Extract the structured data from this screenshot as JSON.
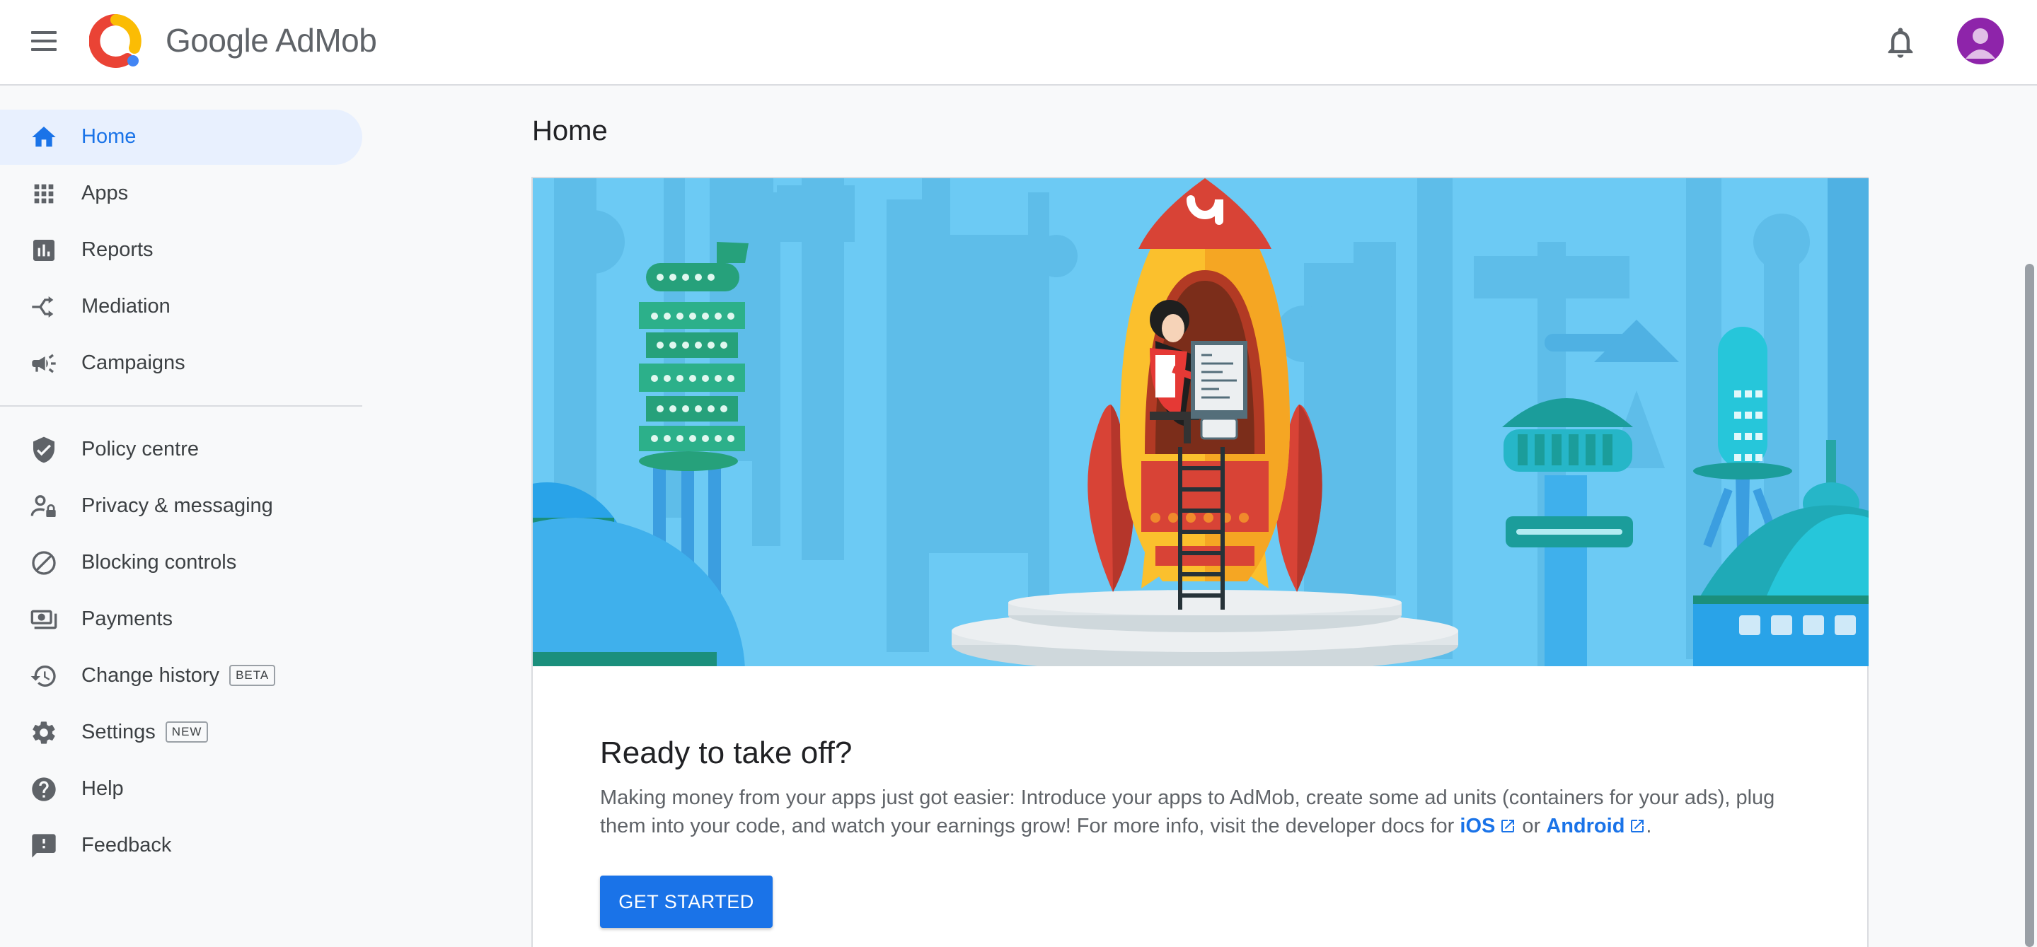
{
  "header": {
    "brand_google": "Google",
    "brand_admob": "AdMob",
    "icons": [
      "menu-icon",
      "admob-logo",
      "notifications-bell-icon",
      "account-avatar"
    ]
  },
  "sidebar": {
    "items": [
      {
        "label": "Home",
        "icon": "home-icon",
        "active": true
      },
      {
        "label": "Apps",
        "icon": "apps-grid-icon"
      },
      {
        "label": "Reports",
        "icon": "bar-chart-icon"
      },
      {
        "label": "Mediation",
        "icon": "mediation-icon"
      },
      {
        "label": "Campaigns",
        "icon": "megaphone-icon"
      },
      {
        "label": "Policy centre",
        "icon": "shield-check-icon"
      },
      {
        "label": "Privacy & messaging",
        "icon": "person-privacy-icon"
      },
      {
        "label": "Blocking controls",
        "icon": "block-icon"
      },
      {
        "label": "Payments",
        "icon": "payments-icon"
      },
      {
        "label": "Change history",
        "icon": "history-icon",
        "badge": "BETA"
      },
      {
        "label": "Settings",
        "icon": "settings-gear-icon",
        "badge": "NEW"
      },
      {
        "label": "Help",
        "icon": "help-icon"
      },
      {
        "label": "Feedback",
        "icon": "feedback-icon"
      }
    ]
  },
  "main": {
    "title": "Home",
    "card": {
      "heading": "Ready to take off?",
      "text_before": "Making money from your apps just got easier: Introduce your apps to AdMob, create some ad units (containers for your ads), plug them into your code, and watch your earnings grow! For more info, visit the developer docs for ",
      "link_ios": "iOS",
      "text_or": " or ",
      "link_android": "Android",
      "text_after": ".",
      "button": "GET STARTED"
    }
  },
  "colors": {
    "accent": "#1a73e8",
    "active_bg": "#e8f0fe",
    "sky": "#6ccaf4",
    "rocket_yellow": "#fbc02d",
    "rocket_red": "#d84336"
  }
}
